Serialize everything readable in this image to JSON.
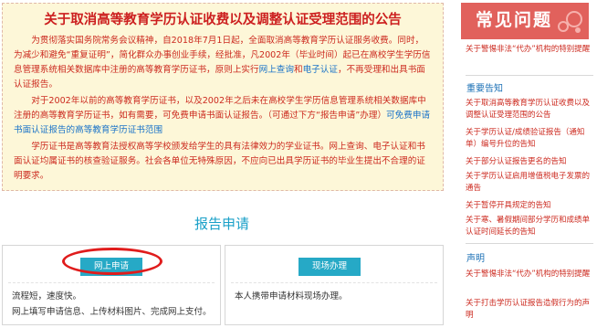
{
  "notice": {
    "title": "关于取消高等教育学历认证收费以及调整认证受理范围的公告",
    "para1_part1": "为贯彻落实国务院常务会议精神，自2018年7月1日起，全面取消高等教育学历认证服务收费。同时，为减少和避免“重复证明”，简化群众办事创业手续，经批准，凡2002年（毕业时间）起已在高校学生学历信息管理系统相关数据库中注册的高等教育学历证书，原则上实行",
    "para1_link1": "网上查询",
    "para1_and": "和",
    "para1_link2": "电子认证",
    "para1_part2": "，不再受理和出具书面认证报告。",
    "para2_text": "对于2002年以前的高等教育学历证书，以及2002年之后未在高校学生学历信息管理系统相关数据库中注册的高等教育学历证书，如有需要，可免费申请书面认证报告。（可通过下方“报告申请”办理）",
    "para2_link": "可免费申请书面认证报告的高等教育学历证书范围",
    "para3_text": "学历证书是高等教育法授权高等学校颁发给学生的具有法律效力的学业证书。网上查询、电子认证和书面认证均属证书的核查验证服务。社会各单位无特殊原因，不应向已出具学历证书的毕业生提出不合理的证明要求。"
  },
  "report": {
    "title": "报告申请",
    "online": {
      "button": "网上申请",
      "line1": "流程短，速度快。",
      "line2": "网上填写申请信息、上传材料图片、完成网上支付。"
    },
    "onsite": {
      "button": "现场办理",
      "line1": "本人携带申请材料现场办理。"
    }
  },
  "sidebar": {
    "faq_title": "常见问题",
    "faq_link": "关于警惕非法“代办”机构的特别提醒",
    "important_heading": "重要告知",
    "important_items": [
      "关于取消高等教育学历认证收费以及调整认证受理范围的公告",
      "关于学历认证/成绩验证报告（通知单）编号升位的告知",
      "关于部分认证报告更名的告知",
      "关于学历认证启用增值税电子发票的通告",
      "关于暂停开具规定的告知",
      "关于寒、暑假期间部分学历和成绩单认证时间延长的告知"
    ],
    "statement_heading": "声明",
    "statement_items": [
      "关于警惕非法“代办”机构的特别提醒",
      "关于打击学历认证报告造假行为的声明"
    ]
  },
  "colors": {
    "notice_red": "#cc2a1f",
    "link_blue": "#1a73c8",
    "accent_teal": "#26a9c6",
    "faq_banner": "#e1615c",
    "highlight_oval": "#e01c1c"
  },
  "icons": [
    "faq-decoration-icon"
  ]
}
